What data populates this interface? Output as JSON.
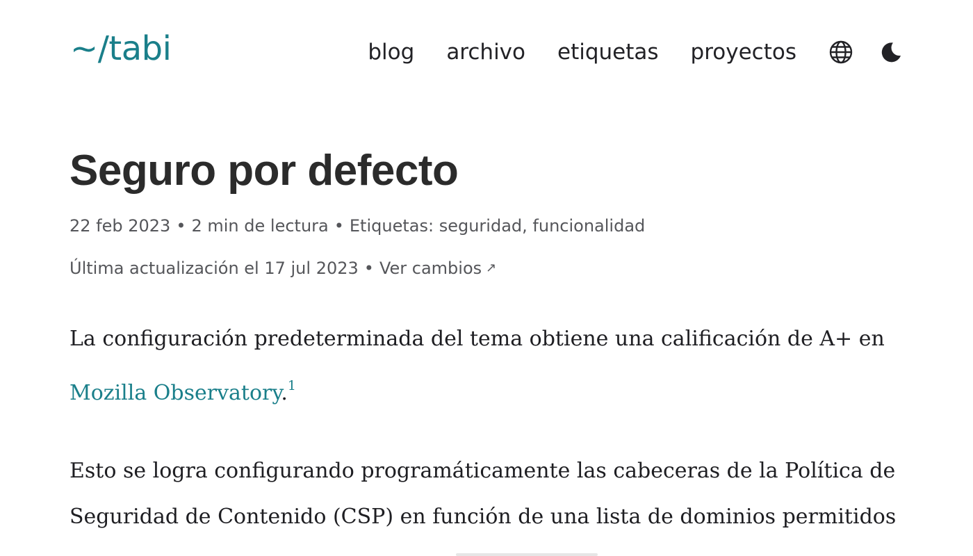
{
  "header": {
    "logo": "~/tabi",
    "nav": [
      "blog",
      "archivo",
      "etiquetas",
      "proyectos"
    ],
    "icons": {
      "language": "globe-icon",
      "theme": "moon-icon"
    },
    "accent_color": "#1a7f8a"
  },
  "article": {
    "title": "Seguro por defecto",
    "date": "22 feb 2023",
    "reading_time": "2 min de lectura",
    "tags_label": "Etiquetas:",
    "tags": [
      "seguridad",
      "funcionalidad"
    ],
    "updated": "Última actualización el 17 jul 2023",
    "changes_link": "Ver cambios",
    "changes_arrow": "↗",
    "separator": "•",
    "paragraph1": {
      "line1": "La configuración predeterminada del tema obtiene una calificación de A+ en",
      "link": "Mozilla Observatory",
      "after_link": ".",
      "footnote": "1"
    },
    "paragraph2": {
      "line1": "Esto se logra configurando programáticamente las cabeceras de la Política de",
      "line2": "Seguridad de Contenido (CSP) en función de una lista de dominios permitidos"
    }
  }
}
